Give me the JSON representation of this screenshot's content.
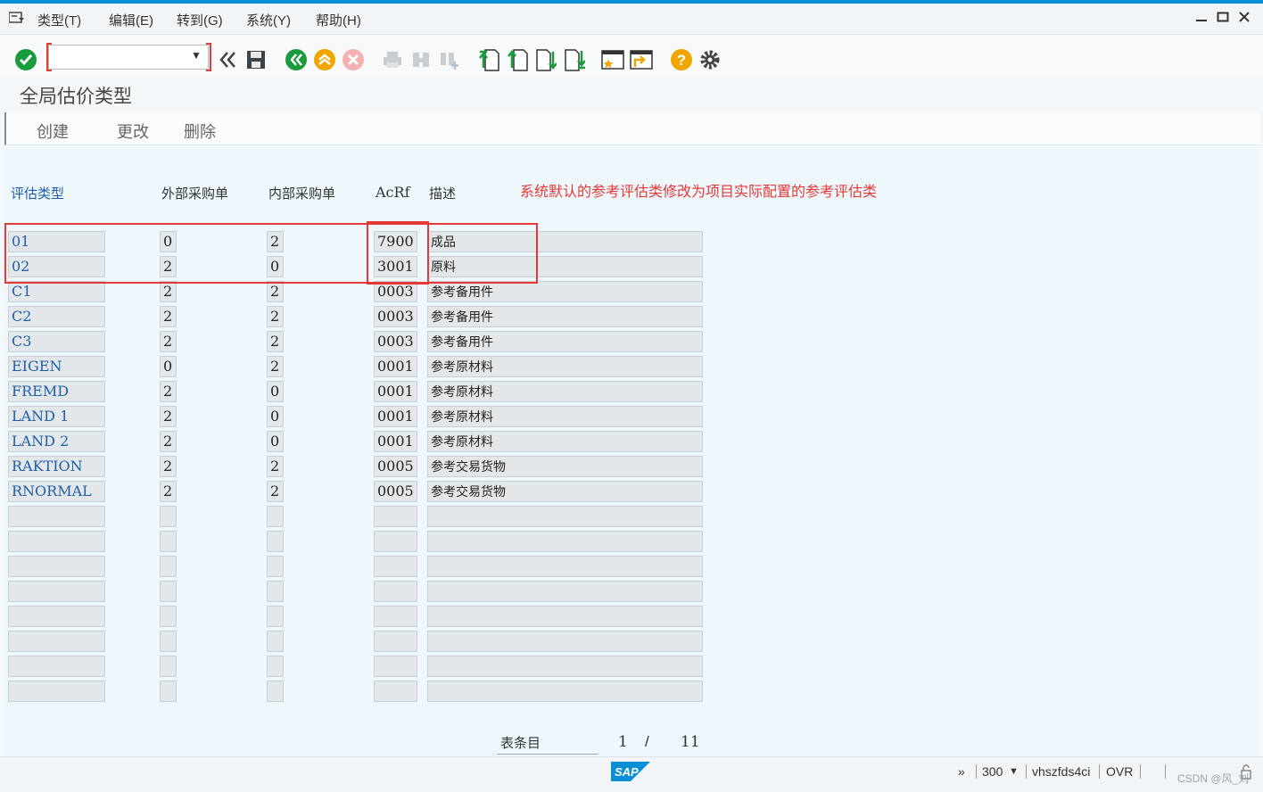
{
  "menu": {
    "items": [
      "类型(T)",
      "编辑(E)",
      "转到(G)",
      "系统(Y)",
      "帮助(H)"
    ]
  },
  "toolbar": {
    "command_value": "",
    "icons": [
      "check-icon",
      "back-double-icon",
      "save-icon",
      "back-icon",
      "exit-icon",
      "cancel-icon",
      "print-icon",
      "find-icon",
      "find-next-icon",
      "first-page-icon",
      "prev-page-icon",
      "next-page-icon",
      "last-page-icon",
      "new-session-icon",
      "shortcut-icon",
      "help-icon",
      "settings-icon"
    ]
  },
  "page": {
    "title": "全局估价类型"
  },
  "app_toolbar": {
    "create": "创建",
    "change": "更改",
    "delete": "删除"
  },
  "table": {
    "headers": {
      "type": "评估类型",
      "ext": "外部采购单",
      "int": "内部采购单",
      "acrf": "AcRf",
      "desc": "描述"
    },
    "rows": [
      {
        "type": "01",
        "ext": "0",
        "int": "2",
        "acrf": "7900",
        "desc": "成品"
      },
      {
        "type": "02",
        "ext": "2",
        "int": "0",
        "acrf": "3001",
        "desc": "原料"
      },
      {
        "type": "C1",
        "ext": "2",
        "int": "2",
        "acrf": "0003",
        "desc": "参考备用件"
      },
      {
        "type": "C2",
        "ext": "2",
        "int": "2",
        "acrf": "0003",
        "desc": "参考备用件"
      },
      {
        "type": "C3",
        "ext": "2",
        "int": "2",
        "acrf": "0003",
        "desc": "参考备用件"
      },
      {
        "type": "EIGEN",
        "ext": "0",
        "int": "2",
        "acrf": "0001",
        "desc": "参考原材料"
      },
      {
        "type": "FREMD",
        "ext": "2",
        "int": "0",
        "acrf": "0001",
        "desc": "参考原材料"
      },
      {
        "type": "LAND 1",
        "ext": "2",
        "int": "0",
        "acrf": "0001",
        "desc": "参考原材料"
      },
      {
        "type": "LAND 2",
        "ext": "2",
        "int": "0",
        "acrf": "0001",
        "desc": "参考原材料"
      },
      {
        "type": "RAKTION",
        "ext": "2",
        "int": "2",
        "acrf": "0005",
        "desc": "参考交易货物"
      },
      {
        "type": "RNORMAL",
        "ext": "2",
        "int": "2",
        "acrf": "0005",
        "desc": "参考交易货物"
      }
    ],
    "empty_rows": 8
  },
  "annotation": {
    "text": "系统默认的参考评估类修改为项目实际配置的参考评估类"
  },
  "pager": {
    "label": "表条目",
    "current": "1",
    "separator": "/",
    "total": "11"
  },
  "status": {
    "more": "»",
    "client": "300",
    "server": "vhszfds4ci",
    "mode": "OVR",
    "watermark": "CSDN @风_刘"
  },
  "colors": {
    "accent": "#0a8ed6",
    "highlight": "#e53935",
    "link": "#1f5fa8"
  }
}
